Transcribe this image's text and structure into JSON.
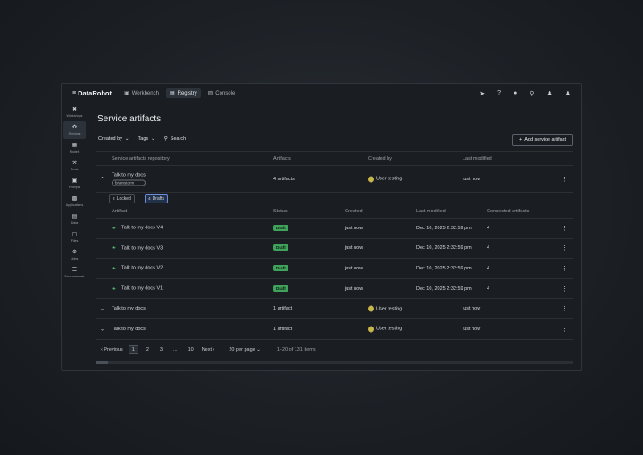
{
  "topbar": {
    "logo": "DataRobot",
    "nav": [
      {
        "label": "Workbench",
        "icon": "workbench-icon"
      },
      {
        "label": "Registry",
        "icon": "registry-icon"
      },
      {
        "label": "Console",
        "icon": "console-icon"
      }
    ],
    "icons": [
      "rocket-icon",
      "help-icon",
      "notifications-icon",
      "search-icon",
      "user-management-icon",
      "profile-icon"
    ],
    "help_glyph": "?"
  },
  "sidebar": {
    "items": [
      {
        "label": "Workshops",
        "icon": "workshop-icon"
      },
      {
        "label": "Models",
        "icon": "models-icon"
      },
      {
        "label": "Models",
        "icon": "models-icon"
      },
      {
        "label": "Tools",
        "icon": "tools-icon"
      },
      {
        "label": "Prompts",
        "icon": "prompts-icon"
      },
      {
        "label": "Applications",
        "icon": "applications-icon"
      },
      {
        "label": "Data",
        "icon": "data-icon"
      },
      {
        "label": "Files",
        "icon": "files-icon"
      },
      {
        "label": "Jobs",
        "icon": "jobs-icon"
      },
      {
        "label": "Environments",
        "icon": "environments-icon"
      }
    ]
  },
  "page": {
    "title": "Service artifacts",
    "filters": {
      "created_by": "Created by",
      "tags": "Tags",
      "search": "Search"
    },
    "add_button": "Add service artifact"
  },
  "table": {
    "headers": {
      "repo": "Service artifacts repository",
      "artifacts": "Artifacts",
      "created_by": "Created by",
      "last_modified": "Last modified"
    },
    "rows": [
      {
        "name": "Talk to my docs",
        "tag": "brainstorm",
        "artifacts": "4 artifacts",
        "created_by": "User testing",
        "last_modified": "just now"
      },
      {
        "name": "Talk to my docs",
        "artifacts": "1 artifact",
        "created_by": "User testing",
        "last_modified": "just now"
      },
      {
        "name": "Talk to my docs",
        "artifacts": "1 artifact",
        "created_by": "User testing",
        "last_modified": "just now"
      }
    ],
    "expanded": {
      "pills": [
        {
          "count": "2",
          "label": "Locked"
        },
        {
          "count": "4",
          "label": "Drafts"
        }
      ],
      "headers": {
        "artifact": "Artifact",
        "status": "Status",
        "created": "Created",
        "last_modified": "Last modified",
        "connected": "Connected artifacts"
      },
      "rows": [
        {
          "name": "Talk to my docs V4",
          "status": "Draft",
          "created": "just now",
          "last_modified": "Dec 10, 2025 2:32:59 pm",
          "connected": "4"
        },
        {
          "name": "Talk to my docs V3",
          "status": "Draft",
          "created": "just now",
          "last_modified": "Dec 10, 2025 2:32:59 pm",
          "connected": "4"
        },
        {
          "name": "Talk to my docs V2",
          "status": "Draft",
          "created": "just now",
          "last_modified": "Dec 10, 2025 2:32:59 pm",
          "connected": "4"
        },
        {
          "name": "Talk to my docs V1",
          "status": "Draft",
          "created": "just now",
          "last_modified": "Dec 10, 2025 2:32:59 pm",
          "connected": "4"
        }
      ]
    }
  },
  "pagination": {
    "previous": "Previous",
    "pages": [
      "1",
      "2",
      "3",
      "...",
      "10"
    ],
    "next": "Next",
    "per_page": "20 per page",
    "range": "1–20 of 131 items"
  },
  "colors": {
    "background": "#1a1d21",
    "draft_badge": "#3fa35c",
    "selected_pill": "#22314a"
  }
}
